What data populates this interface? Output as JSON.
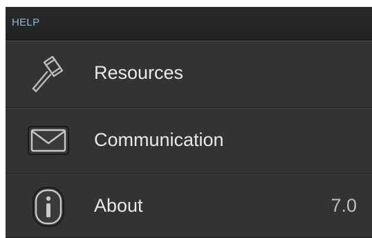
{
  "header": {
    "title": "HELP"
  },
  "items": [
    {
      "label": "Resources",
      "icon": "gavel-icon"
    },
    {
      "label": "Communication",
      "icon": "envelope-icon"
    },
    {
      "label": "About",
      "icon": "info-icon",
      "value": "7.0"
    }
  ],
  "colors": {
    "header_text": "#8fb6d8",
    "row_background": "#333333",
    "label_text": "#e8e8e8"
  }
}
